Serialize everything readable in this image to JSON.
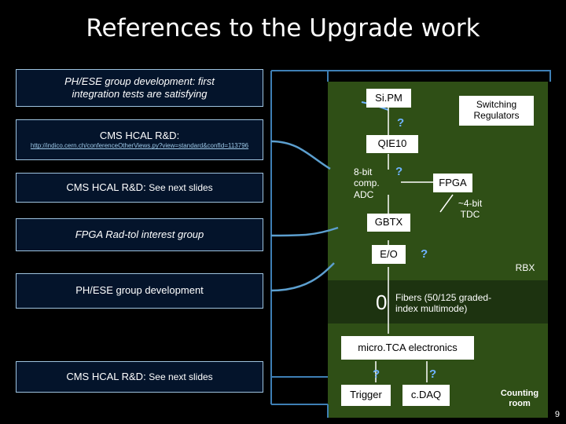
{
  "slide": {
    "title": "References to the Upgrade work",
    "page_number": "9"
  },
  "references": [
    {
      "id": "ref-1",
      "line1": "PH/ESE group development: first",
      "line2": "integration tests are satisfying",
      "style": "italic"
    },
    {
      "id": "ref-2",
      "line1": "CMS HCAL R&D:",
      "url": "http://indico.cern.ch/conferenceOtherViews.py?view=standard&confId=113796",
      "style": "plain"
    },
    {
      "id": "ref-3",
      "line1": "CMS HCAL R&D: ",
      "line2": "See next slides",
      "style": "plain"
    },
    {
      "id": "ref-4",
      "line1": "FPGA Rad-tol interest group",
      "style": "italic"
    },
    {
      "id": "ref-5",
      "line1": "PH/ESE group development",
      "style": "plain"
    },
    {
      "id": "ref-6",
      "line1": "CMS HCAL R&D: ",
      "line2": "See next slides",
      "style": "plain"
    }
  ],
  "diagram": {
    "nodes": {
      "sipm": "Si.PM",
      "qie10": "QIE10",
      "adc": "8-bit\ncomp.\nADC",
      "gbtx": "GBTX",
      "eio": "E/O",
      "fpga": "FPGA",
      "switching_regulators": "Switching\nRegulators",
      "microtca": "micro.TCA electronics",
      "trigger": "Trigger",
      "cdaq": "c.DAQ"
    },
    "labels": {
      "tdc": "~4-bit\nTDC",
      "rbx": "RBX",
      "fibers": "Fibers (50/125 graded-\nindex multimode)",
      "counting_room": "Counting\nroom",
      "zero": "0"
    },
    "question_marks": [
      "?",
      "?",
      "?",
      "?",
      "?",
      "?",
      "?"
    ],
    "accent_color": "#6fb3ff",
    "panel_color": "#2f4f16",
    "box_border_color": "#9fc4e0"
  }
}
